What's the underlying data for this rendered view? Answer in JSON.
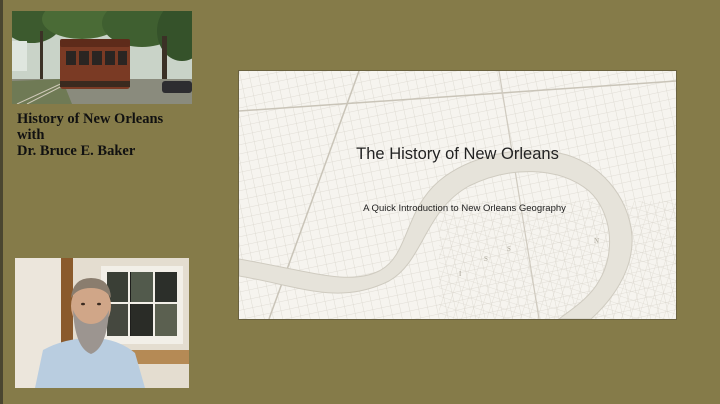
{
  "caption": {
    "line1": "History of New Orleans",
    "line2": "with",
    "line3": "Dr. Bruce E. Baker"
  },
  "slide": {
    "title": "The History of New Orleans",
    "subtitle": "A Quick Introduction to New Orleans Geography"
  },
  "colors": {
    "background": "#857b49",
    "slide_background": "#f6f4ef",
    "river": "#e6e3da"
  },
  "images": {
    "photo": "streetcar-photo",
    "webcam": "presenter-webcam",
    "slide_background": "new-orleans-map"
  }
}
